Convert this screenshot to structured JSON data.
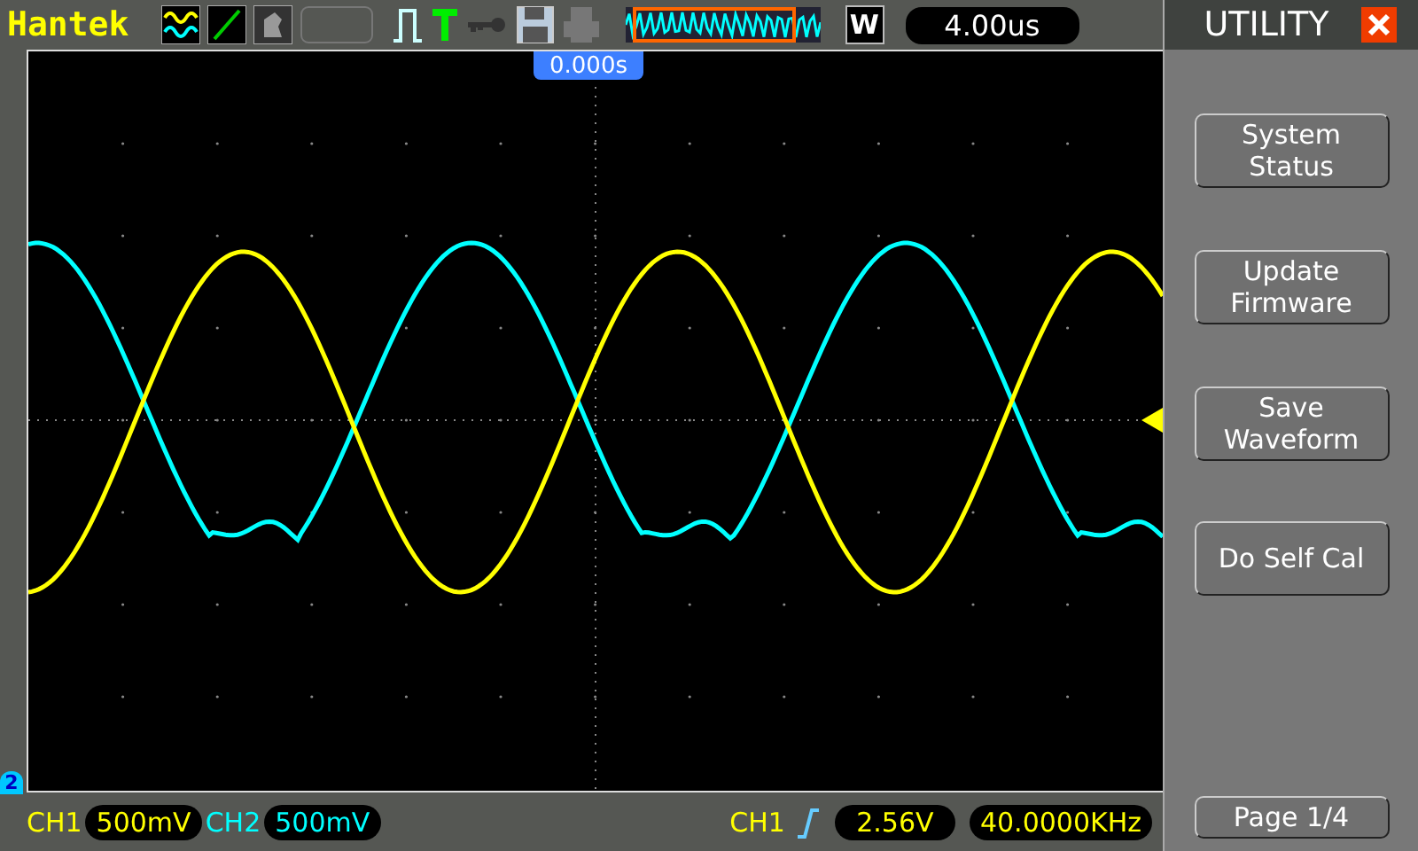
{
  "brand": "Hantek",
  "zoom_mode": "W",
  "timebase": "4.00us",
  "trigger_position": "0.000s",
  "channel_marker": "2",
  "channels": [
    {
      "name": "CH1",
      "scale": "500mV",
      "color": "#ffff00"
    },
    {
      "name": "CH2",
      "scale": "500mV",
      "color": "#00ffff"
    }
  ],
  "trigger": {
    "source": "CH1",
    "level": "2.56V",
    "frequency": "40.0000KHz"
  },
  "menu": {
    "title": "UTILITY",
    "buttons": [
      {
        "lines": [
          "System",
          "Status"
        ]
      },
      {
        "lines": [
          "Update",
          "Firmware"
        ]
      },
      {
        "lines": [
          "Save",
          "Waveform"
        ]
      },
      {
        "lines": [
          "Do Self Cal"
        ]
      }
    ],
    "page": "Page 1/4"
  }
}
